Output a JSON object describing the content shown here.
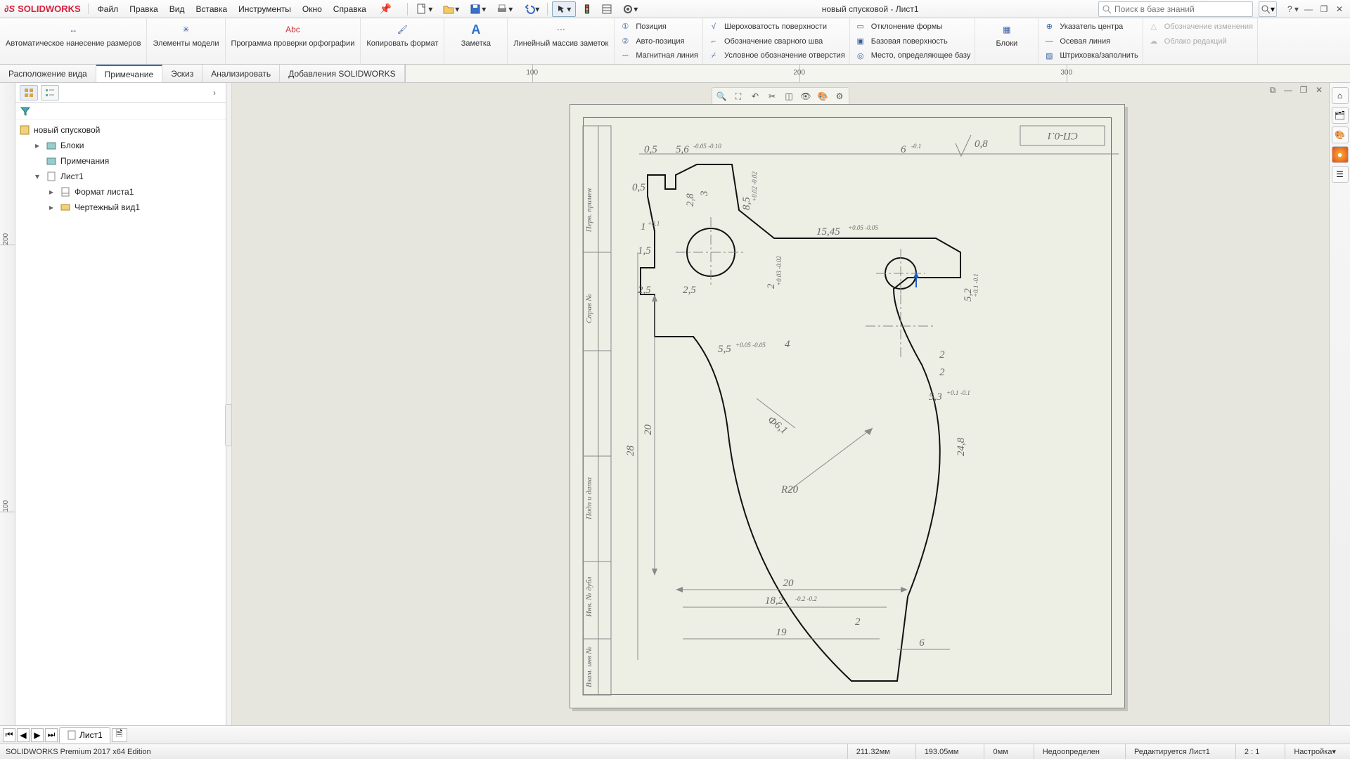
{
  "app": {
    "brand": "SOLIDWORKS",
    "doc_title": "новый спусковой - Лист1"
  },
  "menu": {
    "file": "Файл",
    "edit": "Правка",
    "view": "Вид",
    "insert": "Вставка",
    "tools": "Инструменты",
    "window": "Окно",
    "help": "Справка"
  },
  "search": {
    "placeholder": "Поиск в базе знаний"
  },
  "ribbon": {
    "big": [
      {
        "label": "Автоматическое нанесение размеров"
      },
      {
        "label": "Элементы модели"
      },
      {
        "label": "Программа проверки орфографии"
      },
      {
        "label": "Копировать формат"
      },
      {
        "label": "Заметка"
      },
      {
        "label": "Линейный массив заметок"
      }
    ],
    "col1": [
      "Позиция",
      "Авто-позиция",
      "Магнитная линия"
    ],
    "col2": [
      "Шероховатость поверхности",
      "Обозначение сварного шва",
      "Условное обозначение отверстия"
    ],
    "col3": [
      "Отклонение формы",
      "Базовая поверхность",
      "Место, определяющее базу"
    ],
    "blocks_label": "Блоки",
    "col4": [
      "Указатель центра",
      "Осевая линия",
      "Штриховка/заполнить"
    ],
    "col5": [
      "Обозначение изменения",
      "Облако редакций",
      ""
    ]
  },
  "tabs": {
    "t1": "Расположение вида",
    "t2": "Примечание",
    "t3": "Эскиз",
    "t4": "Анализировать",
    "t5": "Добавления SOLIDWORKS"
  },
  "ruler": {
    "h": [
      {
        "pos": 180,
        "v": "100"
      },
      {
        "pos": 560,
        "v": "200"
      },
      {
        "pos": 940,
        "v": "300"
      }
    ]
  },
  "tree": {
    "root": "новый спусковой",
    "blocks": "Блоки",
    "notes": "Примечания",
    "sheet": "Лист1",
    "format": "Формат листа1",
    "view": "Чертежный вид1"
  },
  "drawing": {
    "title_block": "СП-0.1",
    "side_labels": [
      "Перв. примен",
      "Справ №",
      "Подп и дата",
      "Инв. № дубл",
      "Взам. инв №"
    ],
    "dims": {
      "d05a": "0,5",
      "d56": "5,6",
      "t56": "-0.05\n-0.10",
      "d601": "6",
      "t601": "-0.1",
      "sf": "0,8",
      "d05b": "0,5",
      "d28": "2,8",
      "d3": "3",
      "d85": "8,5",
      "t85": "+0.02\n-0.02",
      "d1": "1",
      "t1": "+0.1",
      "d1545": "15,45",
      "t1545": "+0.05\n-0.05",
      "d15": "1,5",
      "d25a": "2,5",
      "d25b": "2,5",
      "d2": "2",
      "t2": "+0.03\n-0.02",
      "d52": "5,2",
      "t52": "+0.1\n-0.1",
      "d55": "5,5",
      "t55": "+0.05\n-0.05",
      "d4": "4",
      "d53": "5,3",
      "t53": "+0.1\n-0.1",
      "d20v": "20",
      "d28v": "28",
      "phi": "Ф6,1",
      "r20": "R20",
      "d248": "24,8",
      "d20h": "20",
      "d182": "18,2",
      "t182": "-0.2\n-0.2",
      "d19": "19",
      "d2b": "2",
      "d6": "6",
      "d2c": "2",
      "d2d": "2"
    }
  },
  "sheet_tab": {
    "name": "Лист1"
  },
  "status": {
    "edition": "SOLIDWORKS Premium 2017 x64 Edition",
    "x": "211.32мм",
    "y": "193.05мм",
    "z": "0мм",
    "under": "Недоопределен",
    "editing": "Редактируется Лист1",
    "scale": "2 : 1",
    "custom": "Настройка"
  }
}
